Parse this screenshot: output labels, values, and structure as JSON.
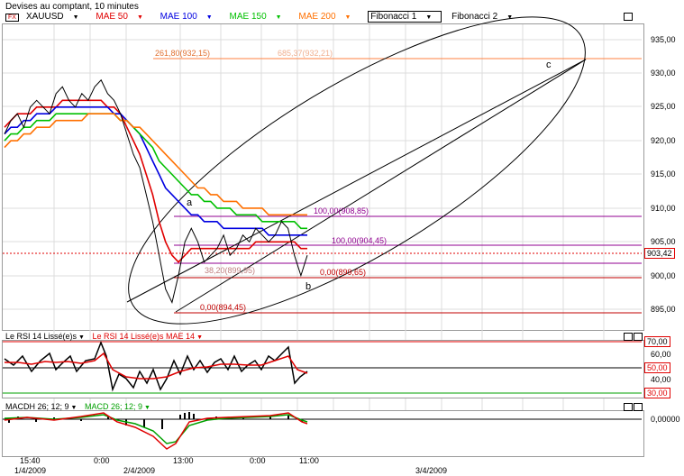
{
  "header": {
    "title": "Devises au comptant, 10 minutes"
  },
  "legend": {
    "symbol": "XAUUSD",
    "symbol_badge": "FX",
    "items": [
      {
        "label": "MAE 50",
        "color": "#e00000"
      },
      {
        "label": "MAE 100",
        "color": "#0000e0"
      },
      {
        "label": "MAE 150",
        "color": "#00c000"
      },
      {
        "label": "MAE 200",
        "color": "#ff7000"
      }
    ],
    "fib1": "Fibonacci 1",
    "fib2": "Fibonacci 2"
  },
  "price_axis": {
    "ticks": [
      "935,00",
      "930,00",
      "925,00",
      "920,00",
      "915,00",
      "910,00",
      "905,00",
      "900,00",
      "895,00"
    ],
    "current": "903,42"
  },
  "fib_labels": {
    "l1": "261,80(932,15)",
    "l2": "685,37(932,21)",
    "l3": "100,00(908,85)",
    "l4": "100,00(904,45)",
    "l5": "38,20(899,95)",
    "l6": "0,00(899,65)",
    "l7": "0,00(894,45)"
  },
  "points": {
    "a": "a",
    "b": "b",
    "c": "c"
  },
  "rsi": {
    "label1": "Le RSI 14 Lissé(e)s",
    "label2": "Le RSI 14 Lissé(e)s MAE 14",
    "ticks": [
      "70,00",
      "60,00",
      "50,00",
      "40,00",
      "30,00"
    ]
  },
  "macd": {
    "label1": "MACDH 26; 12; 9",
    "label2": "MACD 26; 12; 9",
    "tick": "0,00000"
  },
  "time_axis": {
    "row1": [
      "15:40",
      "0:00",
      "13:00",
      "0:00",
      "11:00"
    ],
    "row2": [
      "1/4/2009",
      "2/4/2009",
      "3/4/2009"
    ]
  },
  "chart_data": {
    "type": "line",
    "title": "Devises au comptant, 10 minutes",
    "ylim": [
      892,
      937
    ],
    "series": [
      {
        "name": "XAUUSD",
        "values": [
          921,
          923,
          924,
          922,
          925,
          926,
          925,
          924,
          927,
          928,
          926,
          925,
          927,
          926,
          928,
          929,
          927,
          926,
          924,
          921,
          918,
          916,
          912,
          908,
          903,
          898,
          896,
          900,
          905,
          907,
          905,
          902,
          903,
          904,
          906,
          903,
          904,
          906,
          905,
          907,
          906,
          905,
          906,
          908,
          907,
          903,
          900,
          903
        ]
      },
      {
        "name": "MAE 50",
        "values": [
          922,
          923,
          924,
          924,
          924,
          925,
          925,
          925,
          925,
          926,
          926,
          926,
          926,
          926,
          926,
          926,
          925,
          925,
          924,
          922,
          920,
          918,
          915,
          912,
          908,
          905,
          903,
          902,
          903,
          904,
          904,
          904,
          904,
          904,
          904,
          904,
          904,
          904,
          904,
          905,
          905,
          905,
          905,
          905,
          905,
          905,
          904,
          904
        ]
      },
      {
        "name": "MAE 100",
        "values": [
          921,
          922,
          922,
          923,
          923,
          924,
          924,
          924,
          925,
          925,
          925,
          925,
          925,
          925,
          925,
          925,
          925,
          924,
          924,
          923,
          922,
          921,
          919,
          917,
          915,
          913,
          912,
          911,
          910,
          909,
          909,
          908,
          908,
          908,
          907,
          907,
          907,
          907,
          907,
          907,
          907,
          906,
          906,
          906,
          906,
          906,
          906,
          906
        ]
      },
      {
        "name": "MAE 150",
        "values": [
          920,
          921,
          921,
          922,
          922,
          923,
          923,
          923,
          924,
          924,
          924,
          924,
          924,
          924,
          924,
          924,
          924,
          924,
          923,
          923,
          922,
          921,
          920,
          919,
          917,
          916,
          915,
          914,
          913,
          912,
          912,
          911,
          911,
          910,
          910,
          910,
          909,
          909,
          909,
          909,
          908,
          908,
          908,
          908,
          908,
          908,
          907,
          907
        ]
      },
      {
        "name": "MAE 200",
        "values": [
          919,
          920,
          920,
          921,
          921,
          922,
          922,
          922,
          923,
          923,
          923,
          923,
          923,
          924,
          924,
          924,
          924,
          924,
          923,
          923,
          922,
          922,
          921,
          920,
          919,
          918,
          917,
          916,
          915,
          914,
          913,
          913,
          912,
          912,
          911,
          911,
          911,
          910,
          910,
          910,
          910,
          909,
          909,
          909,
          909,
          909,
          909,
          909
        ]
      }
    ]
  }
}
